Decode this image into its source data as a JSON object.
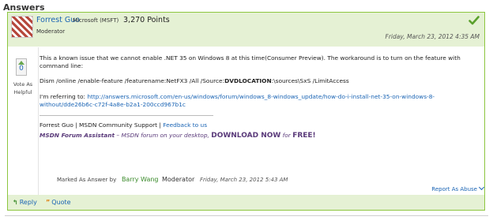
{
  "section_title": "Answers",
  "author": {
    "name": "Forrest Guo",
    "org": "Microsoft (MSFT)",
    "points": "3,270 Points",
    "role": "Moderator"
  },
  "post": {
    "date": "Friday, March 23, 2012 4:35 AM",
    "votes": "0",
    "vote_label": "Vote As Helpful",
    "paragraph1": "This a known issue that we cannot enable .NET 35 on Windows 8 at this time(Consumer Preview). The workaround is to turn on the feature with command line:",
    "command_prefix": "Dism /online /enable-feature /featurename:NetFX3 /All /Source:",
    "command_bold": "DVDLOCATION",
    "command_suffix": ":\\sources\\SxS /LimitAccess",
    "referring_label": "I'm referring to: ",
    "referring_link": "http://answers.microsoft.com/en-us/windows/forum/windows_8-windows_update/how-do-i-install-net-35-on-windows-8-without/dde26b6c-c72f-4a8e-b2a1-200ccd967b1c"
  },
  "signature": {
    "line1_text": "Forrest Guo | MSDN Community Support | ",
    "line1_link": "Feedback to us",
    "assistant_name": "MSDN Forum Assistant",
    "assistant_desc": " – MSDN forum on your desktop, ",
    "download": "DOWNLOAD NOW",
    "for_text": " for ",
    "free": "FREE!"
  },
  "marked": {
    "label": "Marked As Answer by",
    "user": "Barry Wang",
    "role": "Moderator",
    "date": "Friday, March 23, 2012 5:43 AM"
  },
  "actions": {
    "report": "Report As Abuse",
    "reply": "Reply",
    "quote": "Quote"
  },
  "colors": {
    "accent_green": "#8dc63f",
    "header_bg": "#e5f1d4",
    "link_blue": "#1a64b4"
  }
}
